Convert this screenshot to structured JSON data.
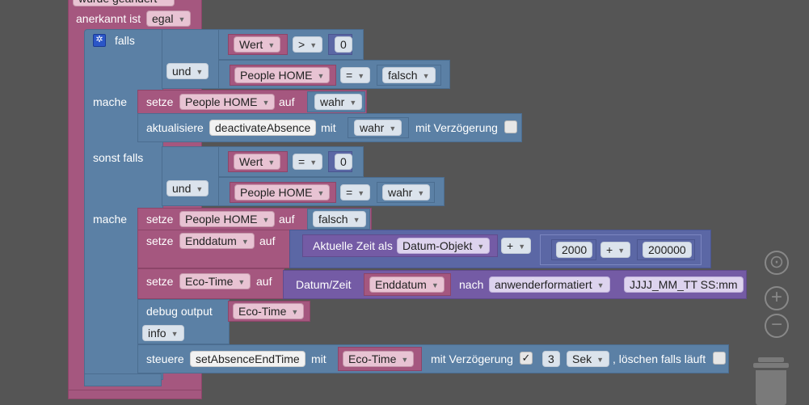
{
  "top_block": {
    "label_cut": "wurde geändert",
    "ack_label": "anerkannt ist",
    "ack_value": "egal"
  },
  "if_block": {
    "falls": "falls",
    "sonst_falls": "sonst falls",
    "mache1": "mache",
    "mache2": "mache"
  },
  "cond1": {
    "var_wert": "Wert",
    "op_gt": ">",
    "num_zero": "0",
    "und": "und",
    "var_people": "People HOME",
    "op_eq": "=",
    "bool_false": "falsch"
  },
  "action1": {
    "setze": "setze",
    "var": "People HOME",
    "auf": "auf",
    "value": "wahr",
    "aktualisiere": "aktualisiere",
    "func": "deactivateAbsence",
    "mit": "mit",
    "arg": "wahr",
    "mit_verz": "mit Verzögerung"
  },
  "cond2": {
    "var_wert": "Wert",
    "op_eq": "=",
    "num_zero": "0",
    "und": "und",
    "var_people": "People HOME",
    "op_eq2": "=",
    "bool_true": "wahr"
  },
  "action2": {
    "setze1": "setze",
    "var1": "People HOME",
    "auf1": "auf",
    "value1": "falsch",
    "setze2": "setze",
    "var2": "Enddatum",
    "auf2": "auf",
    "aktuelle_zeit": "Aktuelle Zeit als",
    "zeit_format": "Datum-Objekt",
    "plus": "+",
    "num1": "2000",
    "plus2": "+",
    "num2": "200000",
    "setze3": "setze",
    "var3": "Eco-Time",
    "auf3": "auf",
    "datum_zeit": "Datum/Zeit",
    "datum_var": "Enddatum",
    "nach": "nach",
    "format_mode": "anwenderformatiert",
    "format_string": "JJJJ_MM_TT SS:mm",
    "debug": "debug output",
    "debug_var": "Eco-Time",
    "debug_level": "info",
    "steuere": "steuere",
    "steuere_func": "setAbsenceEndTime",
    "steuere_mit": "mit",
    "steuere_arg": "Eco-Time",
    "steuere_verz": "mit Verzögerung",
    "check": "✓",
    "delay_num": "3",
    "delay_unit": "Sek",
    "loeschen": ", löschen falls läuft"
  },
  "workspace_controls": {
    "center_icon": "⊙",
    "zoom_in": "+",
    "zoom_out": "−"
  }
}
